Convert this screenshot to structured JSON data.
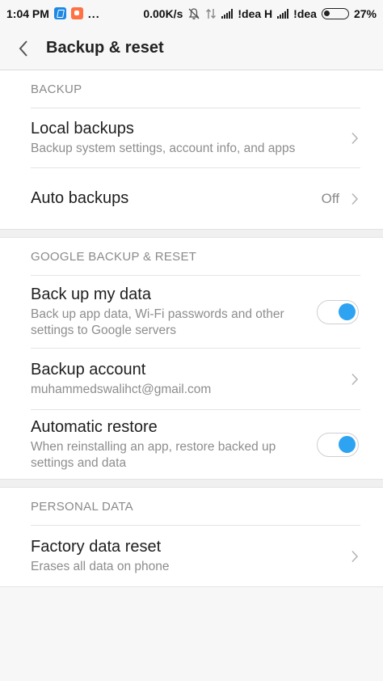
{
  "status_bar": {
    "time": "1:04 PM",
    "dots": "...",
    "speed": "0.00K/s",
    "carrier1": "!dea H",
    "carrier2": "!dea",
    "battery": "27%",
    "icons": [
      "app-badge-blue-icon",
      "app-badge-orange-icon",
      "bell-off-icon",
      "data-arrows-icon",
      "signal-icon",
      "battery-icon"
    ]
  },
  "header": {
    "title": "Backup & reset",
    "back_icon": "chevron-left-icon"
  },
  "sections": {
    "backup": {
      "label": "BACKUP",
      "local_backups": {
        "title": "Local backups",
        "subtitle": "Backup system settings, account info, and apps"
      },
      "auto_backups": {
        "title": "Auto backups",
        "value": "Off"
      }
    },
    "google": {
      "label": "GOOGLE BACKUP & RESET",
      "back_up_data": {
        "title": "Back up my data",
        "subtitle": "Back up app data, Wi-Fi passwords and other settings to Google servers",
        "enabled": true
      },
      "backup_account": {
        "title": "Backup account",
        "subtitle": "muhammedswalihct@gmail.com"
      },
      "automatic_restore": {
        "title": "Automatic restore",
        "subtitle": "When reinstalling an app, restore backed up settings and data",
        "enabled": true
      }
    },
    "personal": {
      "label": "PERSONAL DATA",
      "factory_reset": {
        "title": "Factory data reset",
        "subtitle": "Erases all data on phone"
      }
    }
  },
  "colors": {
    "accent": "#2ea3f2",
    "background": "#f7f7f7",
    "section_label": "#8a8a8a"
  }
}
